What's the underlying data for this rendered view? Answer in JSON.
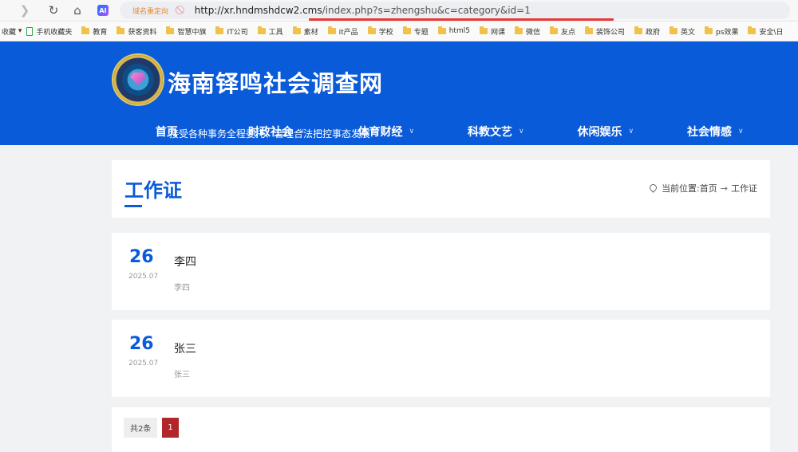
{
  "browser": {
    "domain_redirect": "域名重定向",
    "url_host": "http://xr.hndmshdcw2.cms",
    "url_path": "/index.php?s=zhengshu&c=category&id=1",
    "ai_label": "AI"
  },
  "bookmarks": {
    "first": "收藏",
    "items": [
      "手机收藏夹",
      "教育",
      "获客资料",
      "智慧中旗",
      "IT公司",
      "工具",
      "素材",
      "it产品",
      "学校",
      "专题",
      "html5",
      "网课",
      "微信",
      "友点",
      "装饰公司",
      "政府",
      "英文",
      "ps效果",
      "安全\\日"
    ]
  },
  "site": {
    "title": "海南铎鸣社会调查网",
    "subtitle": "接受各种事务全程委托、合理合法把控事态发展",
    "nav": [
      {
        "label": "首页",
        "dropdown": false
      },
      {
        "label": "时政社会",
        "dropdown": true
      },
      {
        "label": "体育财经",
        "dropdown": true
      },
      {
        "label": "科教文艺",
        "dropdown": true
      },
      {
        "label": "休闲娱乐",
        "dropdown": true
      },
      {
        "label": "社会情感",
        "dropdown": true
      }
    ],
    "brand_color": "#0a5bd9"
  },
  "page": {
    "title": "工作证",
    "breadcrumb_prefix": "当前位置:",
    "breadcrumb_home": "首页",
    "breadcrumb_current": "工作证"
  },
  "items": [
    {
      "day": "26",
      "ym": "2025.07",
      "title": "李四",
      "desc": "李四"
    },
    {
      "day": "26",
      "ym": "2025.07",
      "title": "张三",
      "desc": "张三"
    }
  ],
  "pager": {
    "total": "共2条",
    "current": "1",
    "active_color": "#b1262b"
  }
}
